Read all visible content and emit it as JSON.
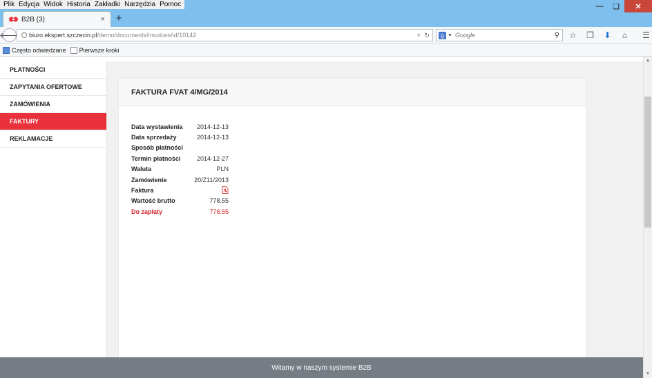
{
  "menu": [
    "Plik",
    "Edycja",
    "Widok",
    "Historia",
    "Zakładki",
    "Narzędzia",
    "Pomoc"
  ],
  "tab": {
    "title": "B2B (3)",
    "close": "×",
    "new": "+"
  },
  "url": {
    "domain": "biuro.ekspert.szczecin.pl",
    "path": "/demo/documents/invoices/id/10142"
  },
  "search": {
    "placeholder": "Google"
  },
  "bookmarks": [
    "Często odwiedzane",
    "Pierwsze kroki"
  ],
  "sidebar": {
    "items": [
      {
        "label": "PŁATNOŚCI",
        "active": false
      },
      {
        "label": "ZAPYTANIA OFERTOWE",
        "active": false
      },
      {
        "label": "ZAMÓWIENIA",
        "active": false
      },
      {
        "label": "FAKTURY",
        "active": true
      },
      {
        "label": "REKLAMACJE",
        "active": false
      }
    ]
  },
  "invoice": {
    "title": "FAKTURA FVAT 4/MG/2014",
    "rows": [
      {
        "label": "Data wystawienia",
        "value": "2014-12-13"
      },
      {
        "label": "Data sprzedaży",
        "value": "2014-12-13"
      },
      {
        "label": "Sposób płatności",
        "value": ""
      },
      {
        "label": "Termin płatności",
        "value": "2014-12-27"
      },
      {
        "label": "Waluta",
        "value": "PLN"
      },
      {
        "label": "Zamówienie",
        "value": "20/Z11/2013"
      },
      {
        "label": "Faktura",
        "value": "",
        "icon": "pdf-icon"
      },
      {
        "label": "Wartość brutto",
        "value": "778.55"
      },
      {
        "label": "Do zapłaty",
        "value": "778.55",
        "highlight": true
      }
    ]
  },
  "footer": {
    "text": "Witamy w naszym systemie B2B"
  },
  "colors": {
    "accent": "#e8313a",
    "footer": "#767c84",
    "titlebar": "#7fbfee"
  }
}
